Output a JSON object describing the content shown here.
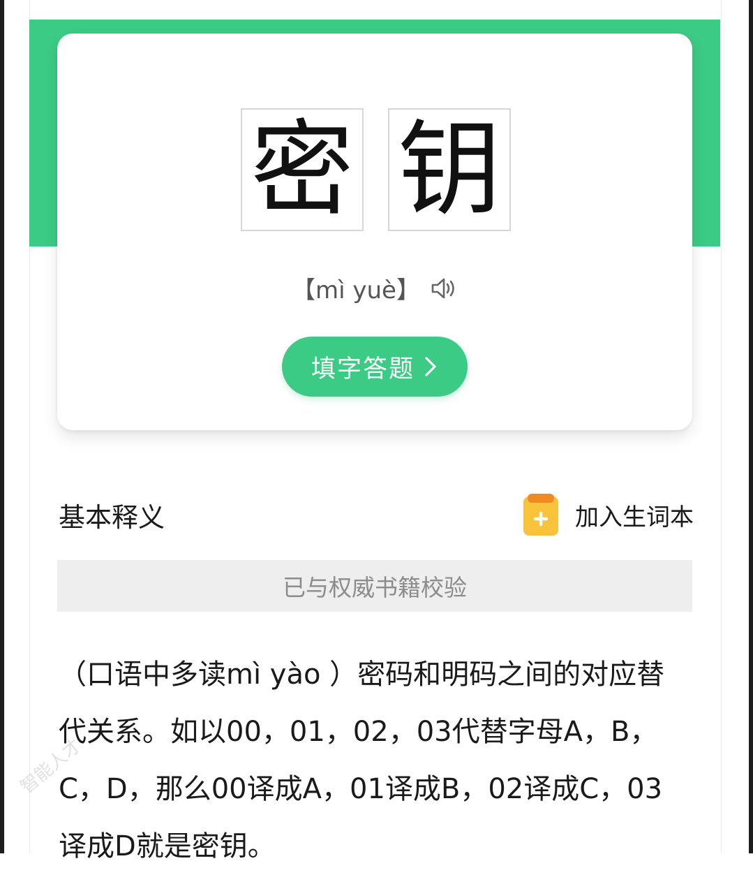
{
  "word": {
    "characters": [
      "密",
      "钥"
    ],
    "pinyin": "【mì yuè】"
  },
  "quiz_button": {
    "label": "填字答题"
  },
  "section": {
    "title": "基本释义",
    "add_vocab_label": "加入生词本",
    "verified_text": "已与权威书籍校验"
  },
  "definition": {
    "text": "（口语中多读mì yào ）密码和明码之间的对应替代关系。如以00，01，02，03代替字母A，B，C，D，那么00译成A，01译成B，02译成C，03译成D就是密钥。"
  },
  "icons": {
    "speaker": "speaker-icon",
    "chevron": "chevron-right-icon",
    "notebook": "notebook-plus-icon"
  },
  "colors": {
    "accent_green": "#3ccb84",
    "notebook_yellow": "#f8c23a",
    "notebook_orange": "#f08a24"
  },
  "watermark": {
    "text": "智能人才"
  }
}
